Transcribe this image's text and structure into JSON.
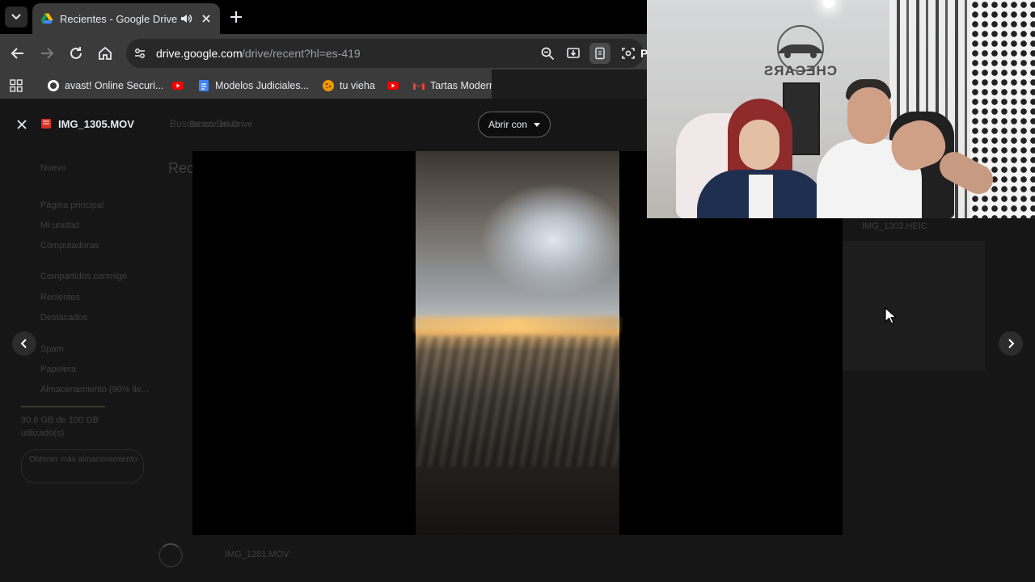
{
  "browser": {
    "tab": {
      "title": "Recientes - Google Drive"
    },
    "address": {
      "host": "drive.google.com",
      "path": "/drive/recent?hl=es-419",
      "trailing": "P"
    },
    "bookmarks": [
      {
        "label": "avast! Online Securi...",
        "icon": "avast-icon"
      },
      {
        "label": "",
        "icon": "youtube-icon"
      },
      {
        "label": "Modelos Judiciales...",
        "icon": "docs-icon"
      },
      {
        "label": "tu vieha",
        "icon": "cookie-icon"
      },
      {
        "label": "",
        "icon": "youtube-icon"
      },
      {
        "label": "Tartas Modern",
        "icon": "gmail-icon"
      }
    ]
  },
  "drive_background": {
    "search_placeholder": "Buscar en Drive",
    "new_label": "Nuevo",
    "heading": "Reci",
    "nav": [
      "Página principal",
      "Mi unidad",
      "Computadoras",
      "Compartidos conmigo",
      "Recientes",
      "Destacados",
      "Spam",
      "Papelera",
      "Almacenamiento (90% lle..."
    ],
    "storage_text": "90,6 GB de 100 GB",
    "storage_sub": "utilizado(s)",
    "get_storage": "Obtener más almacenamiento",
    "right_file": "IMG_1303.HEIC",
    "bottom_file": "IMG_1281.MOV"
  },
  "viewer": {
    "file_name": "IMG_1305.MOV",
    "open_with": "Abrir con"
  },
  "webcam": {
    "logo_text": "CHECARS"
  },
  "colors": {
    "drive_blue": "#4285f4",
    "youtube_red": "#ff0000",
    "movie_red": "#d93025"
  }
}
